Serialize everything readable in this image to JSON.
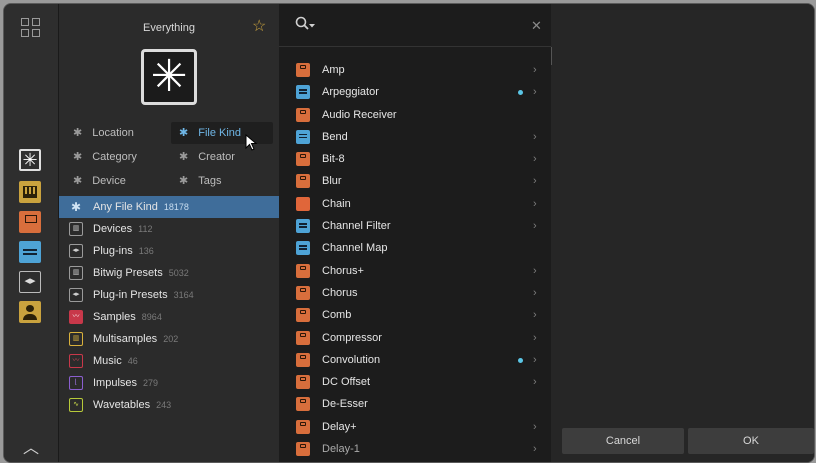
{
  "left_panel": {
    "title": "Everything",
    "filters": [
      {
        "label": "Location"
      },
      {
        "label": "File Kind"
      },
      {
        "label": "Category"
      },
      {
        "label": "Creator"
      },
      {
        "label": "Device"
      },
      {
        "label": "Tags"
      }
    ],
    "file_kinds": [
      {
        "label": "Any File Kind",
        "count": "18178",
        "icon": "asterisk-icon"
      },
      {
        "label": "Devices",
        "count": "112",
        "icon": "device-icon"
      },
      {
        "label": "Plug-ins",
        "count": "136",
        "icon": "plugin-icon"
      },
      {
        "label": "Bitwig Presets",
        "count": "5032",
        "icon": "preset-icon"
      },
      {
        "label": "Plug-in Presets",
        "count": "3164",
        "icon": "plugin-preset-icon"
      },
      {
        "label": "Samples",
        "count": "8964",
        "icon": "sample-icon"
      },
      {
        "label": "Multisamples",
        "count": "202",
        "icon": "multisample-icon"
      },
      {
        "label": "Music",
        "count": "46",
        "icon": "music-icon"
      },
      {
        "label": "Impulses",
        "count": "279",
        "icon": "impulse-icon"
      },
      {
        "label": "Wavetables",
        "count": "243",
        "icon": "wavetable-icon"
      }
    ]
  },
  "results": [
    {
      "label": "Amp",
      "icon": "orange",
      "chevron": true,
      "dot": false
    },
    {
      "label": "Arpeggiator",
      "icon": "blue",
      "chevron": true,
      "dot": true
    },
    {
      "label": "Audio Receiver",
      "icon": "orange",
      "chevron": false,
      "dot": false
    },
    {
      "label": "Bend",
      "icon": "blue",
      "chevron": true,
      "dot": false
    },
    {
      "label": "Bit-8",
      "icon": "orange",
      "chevron": true,
      "dot": false
    },
    {
      "label": "Blur",
      "icon": "orange",
      "chevron": true,
      "dot": false
    },
    {
      "label": "Chain",
      "icon": "chain",
      "chevron": true,
      "dot": false
    },
    {
      "label": "Channel Filter",
      "icon": "blue",
      "chevron": true,
      "dot": false
    },
    {
      "label": "Channel Map",
      "icon": "blue",
      "chevron": false,
      "dot": false
    },
    {
      "label": "Chorus+",
      "icon": "orange",
      "chevron": true,
      "dot": false
    },
    {
      "label": "Chorus",
      "icon": "orange",
      "chevron": true,
      "dot": false
    },
    {
      "label": "Comb",
      "icon": "orange",
      "chevron": true,
      "dot": false
    },
    {
      "label": "Compressor",
      "icon": "orange",
      "chevron": true,
      "dot": false
    },
    {
      "label": "Convolution",
      "icon": "orange",
      "chevron": true,
      "dot": true
    },
    {
      "label": "DC Offset",
      "icon": "orange",
      "chevron": true,
      "dot": false
    },
    {
      "label": "De-Esser",
      "icon": "orange",
      "chevron": false,
      "dot": false
    },
    {
      "label": "Delay+",
      "icon": "orange",
      "chevron": true,
      "dot": false
    },
    {
      "label": "Delay-1",
      "icon": "orange",
      "chevron": true,
      "dot": false
    }
  ],
  "footer": {
    "cancel": "Cancel",
    "ok": "OK"
  },
  "colors": {
    "selection": "#3f6d9a",
    "accent": "#6fb6e6",
    "device": "#d86e3c",
    "note_fx": "#4ea3d6",
    "star": "#c9a23e"
  }
}
